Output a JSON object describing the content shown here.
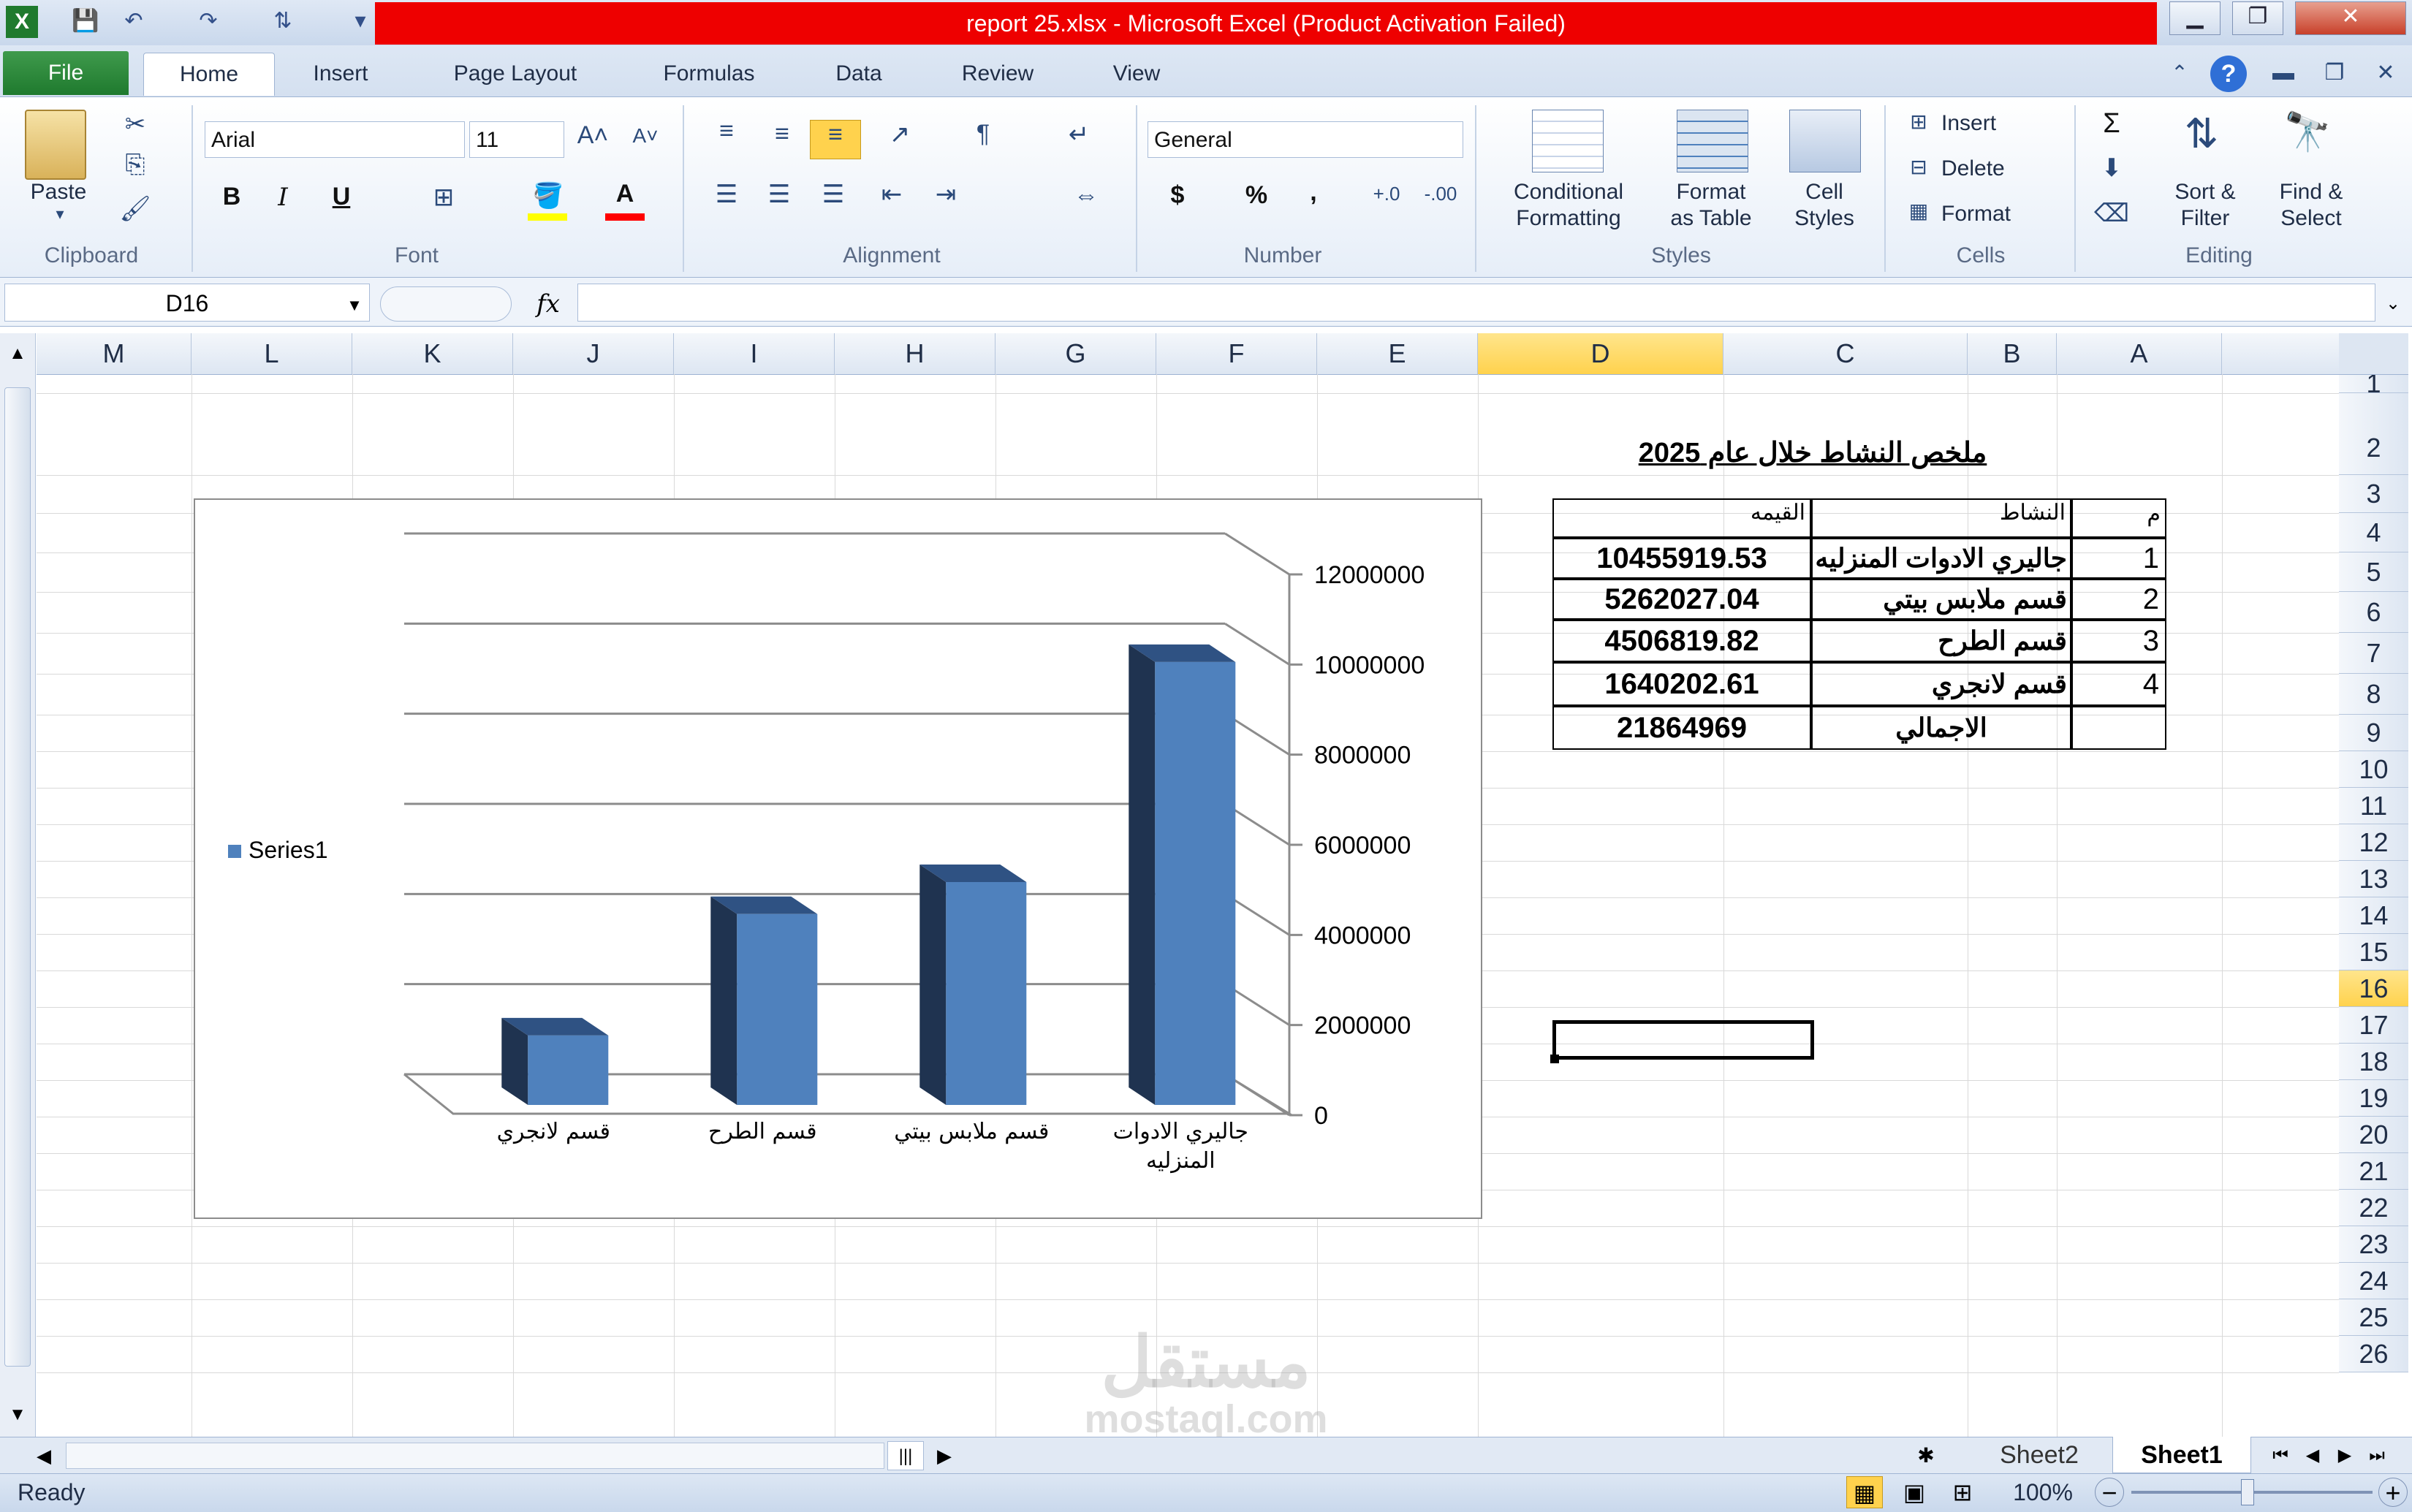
{
  "window": {
    "title": "report 25.xlsx  -  Microsoft Excel (Product Activation Failed)",
    "minimize": "▁",
    "restore": "❐",
    "close": "✕"
  },
  "tabs": {
    "file": "File",
    "items": [
      "Home",
      "Insert",
      "Page Layout",
      "Formulas",
      "Data",
      "Review",
      "View"
    ]
  },
  "ribbon": {
    "clipboard": {
      "paste": "Paste",
      "label": "Clipboard"
    },
    "font": {
      "name": "Arial",
      "size": "11",
      "bold": "B",
      "italic": "I",
      "underline": "U",
      "label": "Font"
    },
    "alignment": {
      "label": "Alignment"
    },
    "number": {
      "format": "General",
      "currency": "$",
      "percent": "%",
      "comma": ",",
      "label": "Number"
    },
    "styles": {
      "conditional_1": "Conditional",
      "conditional_2": "Formatting",
      "format_table_1": "Format",
      "format_table_2": "as Table",
      "cell_styles_1": "Cell",
      "cell_styles_2": "Styles",
      "label": "Styles"
    },
    "cells": {
      "insert": "Insert",
      "delete": "Delete",
      "format": "Format",
      "label": "Cells"
    },
    "editing": {
      "sort_1": "Sort &",
      "sort_2": "Filter",
      "find_1": "Find &",
      "find_2": "Select",
      "label": "Editing"
    }
  },
  "formula_bar": {
    "name_box": "D16",
    "fx": "fx",
    "value": ""
  },
  "columns": [
    "M",
    "L",
    "K",
    "J",
    "I",
    "H",
    "G",
    "F",
    "E",
    "D",
    "C",
    "B",
    "A"
  ],
  "rows": [
    "1",
    "2",
    "3",
    "4",
    "5",
    "6",
    "7",
    "8",
    "9",
    "10",
    "11",
    "12",
    "13",
    "14",
    "15",
    "16",
    "17",
    "18",
    "19",
    "20",
    "21",
    "22",
    "23",
    "24",
    "25",
    "26"
  ],
  "sheet_table": {
    "title": "ملخص النشاط خلال عام 2025",
    "headers": {
      "num": "م",
      "activity": "النشاط",
      "value": "القيمه"
    },
    "rows": [
      {
        "num": "1",
        "activity": "جاليري الادوات المنزليه",
        "value": "10455919.53"
      },
      {
        "num": "2",
        "activity": "قسم ملابس بيتي",
        "value": "5262027.04"
      },
      {
        "num": "3",
        "activity": "قسم الطرح",
        "value": "4506819.82"
      },
      {
        "num": "4",
        "activity": "قسم لانجري",
        "value": "1640202.61"
      }
    ],
    "total_label": "الاجمالي",
    "total_value": "21864969"
  },
  "chart_data": {
    "type": "bar",
    "categories": [
      "قسم لانجري",
      "قسم الطرح",
      "قسم ملابس بيتي",
      "جاليري الادوات المنزليه"
    ],
    "category_lines": [
      [
        "قسم لانجري"
      ],
      [
        "قسم الطرح"
      ],
      [
        "قسم ملابس بيتي"
      ],
      [
        "جاليري الادوات",
        "المنزليه"
      ]
    ],
    "series": [
      {
        "name": "Series1",
        "values": [
          1640202.61,
          4506819.82,
          5262027.04,
          10455919.53
        ]
      }
    ],
    "ylim": [
      0,
      12000000
    ],
    "yticks": [
      "0",
      "2000000",
      "4000000",
      "6000000",
      "8000000",
      "10000000",
      "12000000"
    ],
    "y_axis_side": "right",
    "legend": "left",
    "grid": true,
    "style": "3d-column",
    "color": "#4f81bd"
  },
  "sheets": {
    "sheet2": "Sheet2",
    "sheet1": "Sheet1"
  },
  "status": {
    "ready": "Ready",
    "zoom": "100%"
  },
  "watermark": {
    "line1": "مستقل",
    "line2": "mostaql.com"
  }
}
